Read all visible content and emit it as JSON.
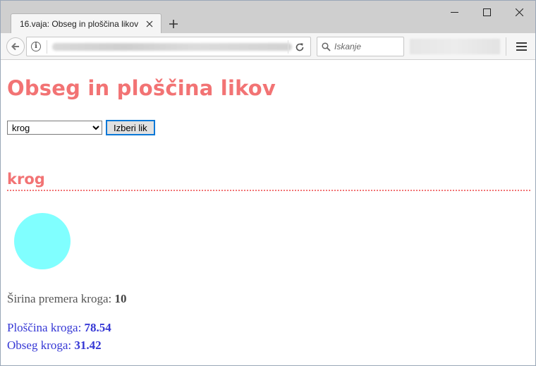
{
  "browser": {
    "tab_title": "16.vaja: Obseg in ploščina likov",
    "search_placeholder": "Iskanje"
  },
  "page": {
    "title": "Obseg in ploščina likov",
    "select": {
      "selected": "krog",
      "options": [
        "krog"
      ]
    },
    "submit_label": "Izberi lik",
    "shape_heading": "krog",
    "shape_color": "#80ffff",
    "heading_color": "#f27374",
    "result_color": "#3537d5",
    "diameter": {
      "label": "Širina premera kroga:",
      "value": "10"
    },
    "area": {
      "label": "Ploščina kroga:",
      "value": "78.54"
    },
    "perimeter": {
      "label": "Obseg kroga:",
      "value": "31.42"
    }
  }
}
